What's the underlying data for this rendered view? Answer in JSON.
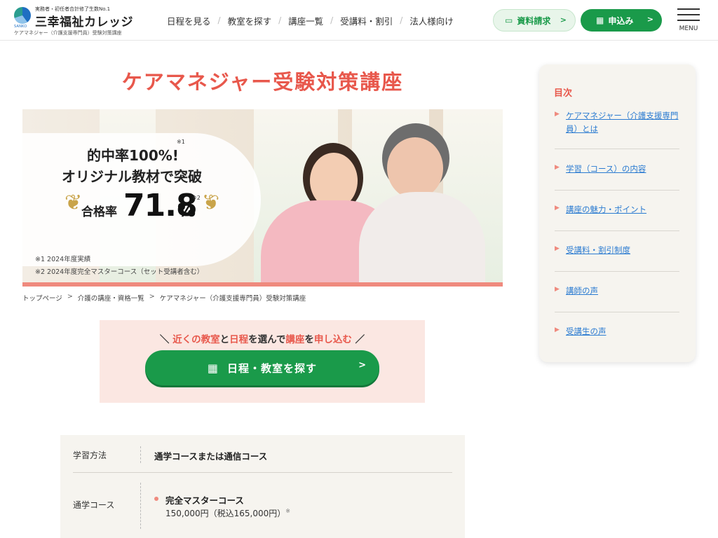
{
  "header": {
    "logo_tagline": "実務者・初任者合計修了生数No.1",
    "logo_name": "三幸福祉カレッジ",
    "logo_mark_sub": "SANKO",
    "logo_sub": "ケアマネジャー（介護支援専門員）受験対策講座",
    "nav": [
      {
        "label": "日程を見る"
      },
      {
        "label": "教室を探す"
      },
      {
        "label": "講座一覧"
      },
      {
        "label": "受講料・割引"
      },
      {
        "label": "法人様向け"
      }
    ],
    "nav_separator": "/",
    "doc_request_label": "資料請求",
    "apply_label": "申込み",
    "menu_label": "MENU",
    "colors": {
      "green": "#1a9a4a",
      "accent": "#e8584c"
    }
  },
  "main": {
    "page_title": "ケアマネジャー受験対策講座",
    "hero": {
      "line1": "的中率100%!",
      "line2": "オリジナル教材で突破",
      "rate_label": "合格率",
      "rate_value": "71.8",
      "rate_unit": "%",
      "note_mark1": "※1",
      "note_mark2": "※2",
      "footnote1": "※1  2024年度実績",
      "footnote2": "※2  2024年度完全マスターコース（セット受講者含む）"
    },
    "breadcrumb": [
      "トップページ",
      "介護の講座・資格一覧",
      "ケアマネジャー（介護支援専門員）受験対策講座"
    ],
    "breadcrumb_sep": ">",
    "cta": {
      "lead_open": "＼",
      "lead_p1": "近くの教室",
      "lead_t1": "と",
      "lead_p2": "日程",
      "lead_t2": "を選んで",
      "lead_p3": "講座",
      "lead_t3": "を",
      "lead_p4": "申し込む",
      "lead_close": "／",
      "button_label": "日程・教室を探す"
    },
    "info": {
      "row1_label": "学習方法",
      "row1_value": "通学コースまたは通信コース",
      "row2_label": "通学コース",
      "row2_course": "完全マスターコース",
      "row2_price": "150,000円（税込165,000円）",
      "row2_note": "※"
    }
  },
  "toc": {
    "title": "目次",
    "items": [
      {
        "label": "ケアマネジャー（介護支援専門員）とは"
      },
      {
        "label": "学習（コース）の内容"
      },
      {
        "label": "講座の魅力・ポイント"
      },
      {
        "label": "受講料・割引制度"
      },
      {
        "label": "講師の声"
      },
      {
        "label": "受講生の声"
      }
    ]
  }
}
